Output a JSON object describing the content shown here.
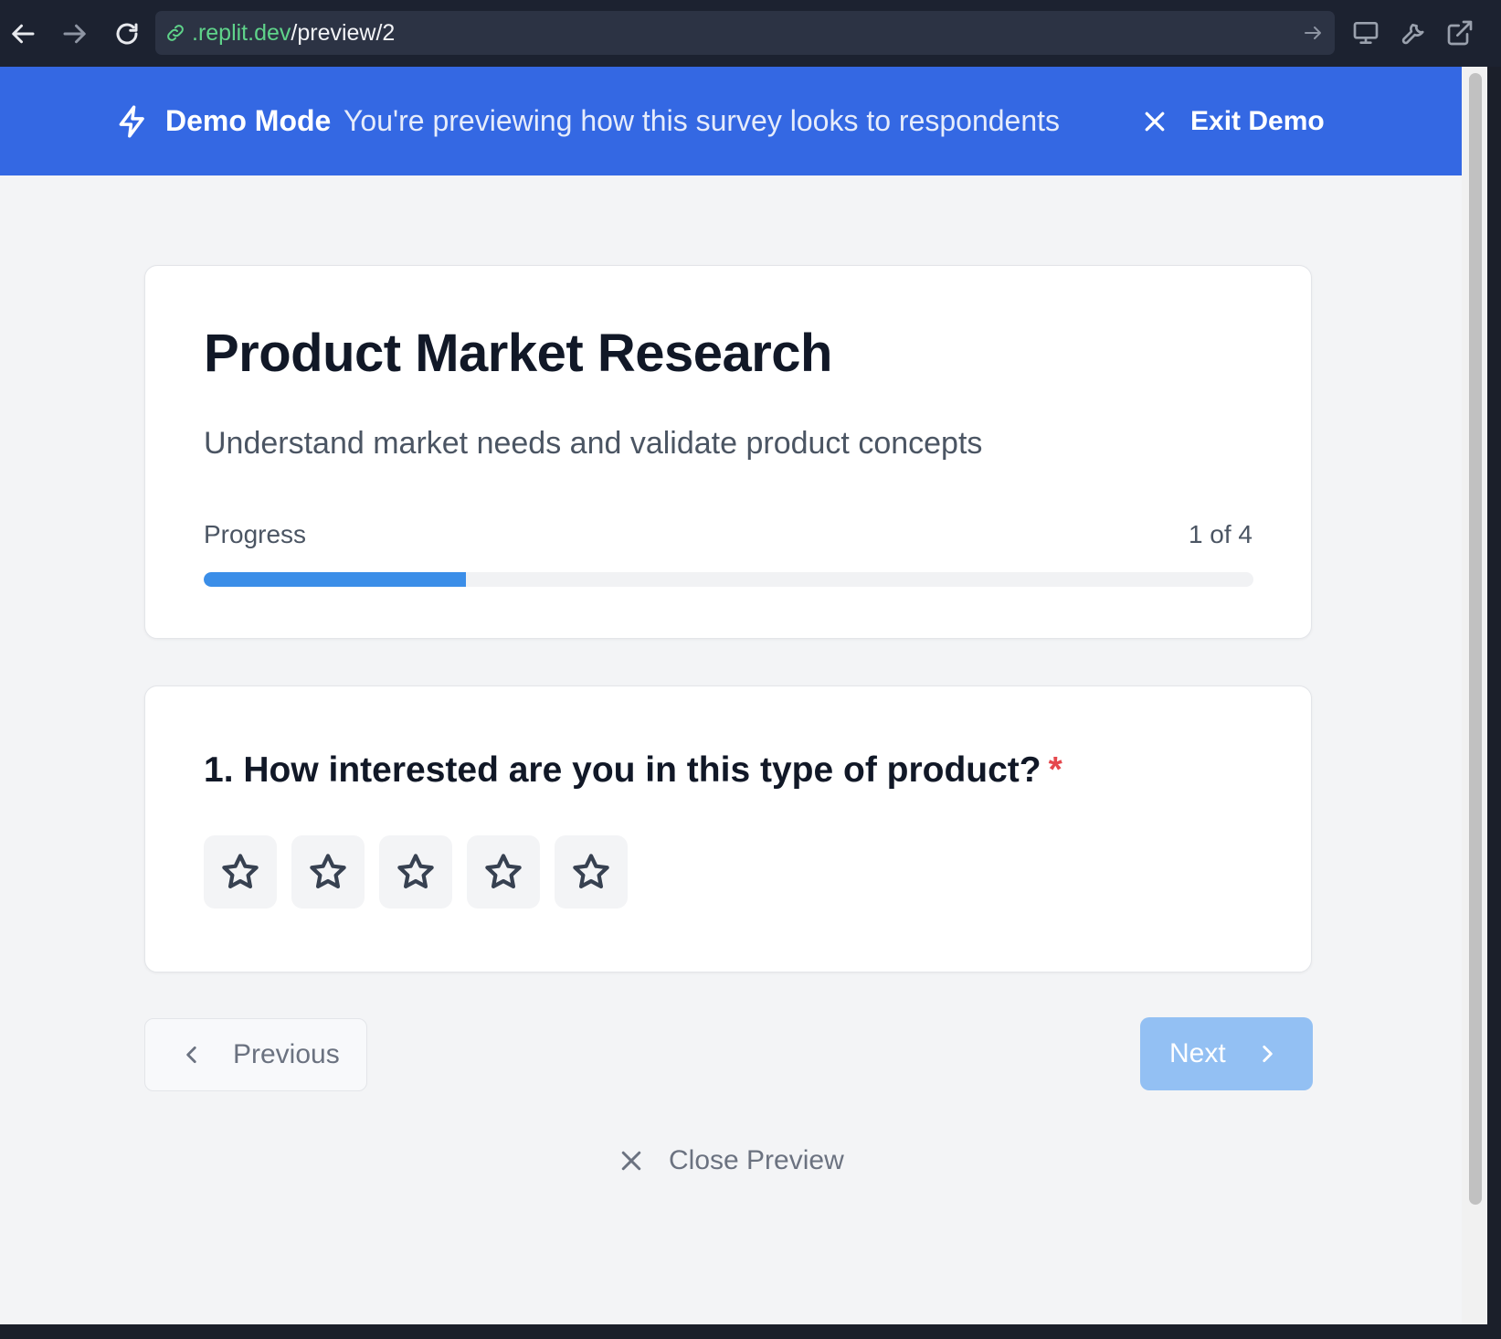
{
  "browser": {
    "url_host": ".replit.dev",
    "url_path": "/preview/2",
    "icons": [
      "back-arrow-icon",
      "forward-arrow-icon",
      "reload-icon",
      "link-icon",
      "go-arrow-icon",
      "monitor-icon",
      "wrench-icon",
      "external-link-icon"
    ]
  },
  "banner": {
    "title": "Demo Mode",
    "description": "You're previewing how this survey looks to respondents",
    "exit_label": "Exit Demo",
    "background": "#3468e3"
  },
  "survey": {
    "title": "Product Market Research",
    "description": "Understand market needs and validate product concepts",
    "progress_label": "Progress",
    "progress_count": "1 of 4",
    "progress_fraction": 0.25
  },
  "question": {
    "text": "1. How interested are you in this type of product?",
    "required_mark": "*",
    "rating_max": 5,
    "rating_value": 0
  },
  "navigation": {
    "previous_label": "Previous",
    "next_label": "Next",
    "close_label": "Close Preview"
  },
  "colors": {
    "accent": "#3b8ee8",
    "next_disabled": "#93c0f3",
    "required": "#e5484d",
    "url_host": "#5fd38a"
  }
}
